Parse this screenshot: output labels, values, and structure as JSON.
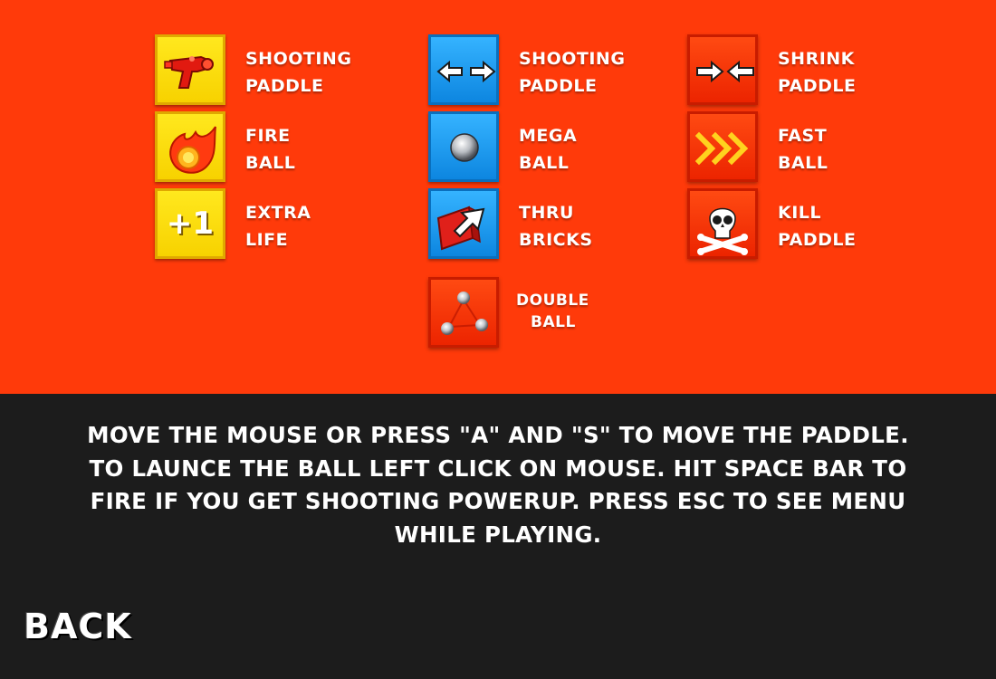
{
  "powerups": {
    "shooting_paddle_gun": {
      "line1": "SHOOTING",
      "line2": "PADDLE",
      "icon": "ray-gun-icon",
      "color": "#ffe81e"
    },
    "fire_ball": {
      "line1": "FIRE",
      "line2": "BALL",
      "icon": "fireball-icon",
      "color": "#ffe81e"
    },
    "extra_life": {
      "line1": "EXTRA",
      "line2": "LIFE",
      "icon": "plus-one-icon",
      "icon_text": "+1",
      "color": "#ffe81e"
    },
    "shooting_paddle_expand": {
      "line1": "SHOOTING",
      "line2": "PADDLE",
      "icon": "expand-arrows-icon",
      "color": "#35b3ff"
    },
    "mega_ball": {
      "line1": "MEGA",
      "line2": "BALL",
      "icon": "steel-ball-icon",
      "color": "#35b3ff"
    },
    "thru_bricks": {
      "line1": "THRU",
      "line2": "BRICKS",
      "icon": "brick-arrow-icon",
      "color": "#35b3ff"
    },
    "double_ball": {
      "line1": "DOUBLE",
      "line2": "BALL",
      "icon": "triple-balls-icon",
      "color": "#ff4a12"
    },
    "shrink_paddle": {
      "line1": "SHRINK",
      "line2": "PADDLE",
      "icon": "shrink-arrows-icon",
      "color": "#ff4a12"
    },
    "fast_ball": {
      "line1": "FAST",
      "line2": "BALL",
      "icon": "chevrons-right-icon",
      "color": "#ff4a12"
    },
    "kill_paddle": {
      "line1": "KILL",
      "line2": "PADDLE",
      "icon": "skull-crossbones-icon",
      "color": "#ff4a12"
    }
  },
  "instructions": {
    "line1": "MOVE THE MOUSE OR PRESS \"A\" AND \"S\" TO MOVE THE PADDLE.",
    "line2": "TO LAUNCE THE BALL LEFT CLICK ON MOUSE. HIT SPACE BAR TO",
    "line3": "FIRE IF YOU GET SHOOTING POWERUP. PRESS ESC TO SEE MENU",
    "line4": "WHILE PLAYING."
  },
  "back_button": {
    "label": "BACK"
  },
  "colors": {
    "top_background": "#ff3a0a",
    "bottom_background": "#1c1c1c"
  }
}
